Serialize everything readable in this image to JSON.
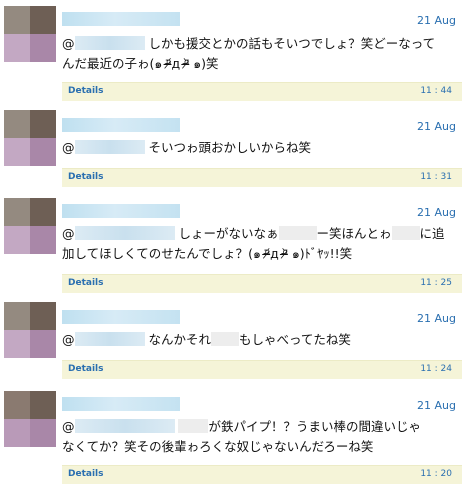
{
  "tweets": [
    {
      "date": "21 Aug",
      "at": "@",
      "line1": "しかも援交とかの話もそいつでしょ？笑どーなって",
      "line2": "んだ最近の子ゎ(๑ ᵒ̴̶̷᷄д ᵒ̴̶̷᷅ ๑)笑",
      "details": "Details",
      "time": "11 : 44"
    },
    {
      "date": "21 Aug",
      "at": "@",
      "line1": "そいつゎ頭おかしいからね笑",
      "details": "Details",
      "time": "11 : 31"
    },
    {
      "date": "21 Aug",
      "at": "@",
      "line1a": "しょーがないなぁ",
      "line1b": "ー笑ほんとゎ",
      "line1c": "に追",
      "line2": "加してほしくてのせたんでしょ？(๑ ᵒ̴̶̷᷄д ᵒ̴̶̷᷅ ๑)ﾄﾞﾔｯ!!笑",
      "details": "Details",
      "time": "11 : 25"
    },
    {
      "date": "21 Aug",
      "at": "@",
      "line1a": "なんかそれ",
      "line1b": "もしゃべってたね笑",
      "details": "Details",
      "time": "11 : 24"
    },
    {
      "date": "21 Aug",
      "at": "@",
      "line1": "が鉄パイプ！？うまい棒の間違いじゃ",
      "line2": "なくてか？笑その後輩ゎろくな奴じゃないんだろーね笑",
      "details": "Details",
      "time": "11 : 20"
    }
  ]
}
